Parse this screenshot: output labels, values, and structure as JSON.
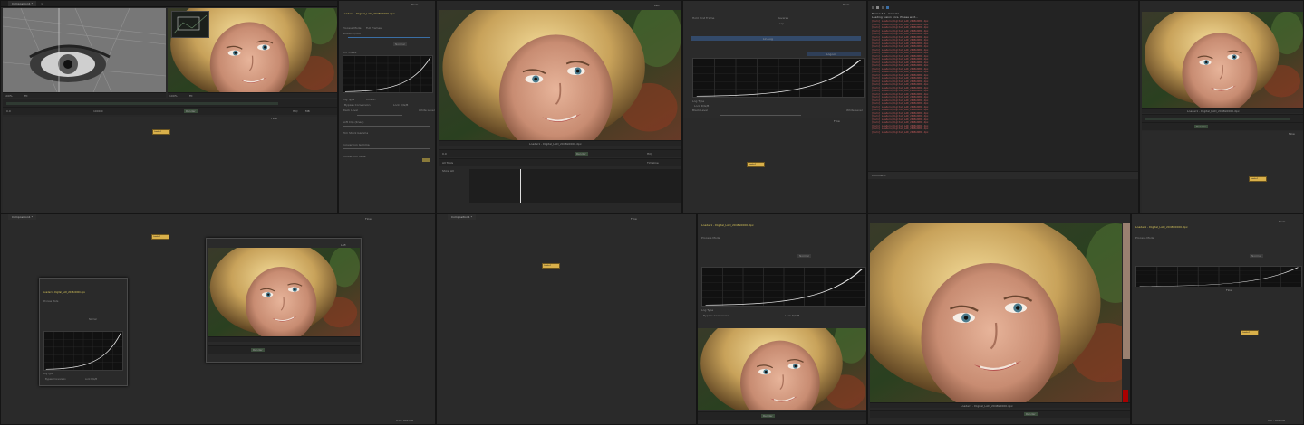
{
  "composition_tab": "Composition1 *",
  "loader_name": "Loader1 - Digital_LAD_2048x0000.dpx",
  "filename_caption": "Loader1 - Digital_LAD_2048x0000.dpx",
  "node_label": "Loader1",
  "inspector": {
    "tools_tab": "Tools",
    "modifiers_tab": "Modifiers",
    "process_mode_label": "Process Mode",
    "process_mode_value": "Full Frames",
    "global_in_label": "Global In/Out",
    "global_in_value": "0.0",
    "global_out_value": "100.0",
    "hold_label": "Hold First Frame",
    "reverse_label": "Reverse",
    "loop_label": "Loop",
    "normal_label": "Normal",
    "bypass_label": "Bypass Conversion",
    "lock_label": "Lock R/G/B",
    "log_type_label": "Log Type",
    "log_type_value": "Cineon",
    "black_level_label": "Black Level",
    "white_level_label": "White Level",
    "black_level_value": "95",
    "white_level_value": "685",
    "soft_clip_label": "Soft Clip (Knee)",
    "film_stock_label": "Film Stock Gamma",
    "conversion_gamma_label": "Conversion Gamma",
    "conversion_table_label": "Conversion Table",
    "lin_log_label": "Lin-Log",
    "log_lin_label": "Log-Lin",
    "curve_label": "LUT Curve"
  },
  "viewer": {
    "left_label": "Left",
    "right_label": "Right",
    "zoom": "100%",
    "fit": "Fit",
    "frame_start": "0.0",
    "frame_end": "1000.0",
    "render_label": "Render",
    "hiq": "HiQ",
    "mb": "MB",
    "prx": "Prx",
    "aprx": "APrx",
    "some_label": "Some"
  },
  "flow_panel": {
    "flow_tab": "Flow",
    "console_tab": "Console",
    "timeline_tab": "Timeline",
    "spline_tab": "Spline",
    "status": "0% - 404 MB"
  },
  "timeline_panel": {
    "title": "Timeline",
    "all_tools": "All Tools",
    "show_all": "Show All"
  },
  "console_panel": {
    "search_label": "Search",
    "command_label": "Command",
    "header": "Fusion 7.0 - Console",
    "header2": "Loading fusion core. Please wait...",
    "lines": [
      "[Warn] Loaders/Digital_LAD_2048x0000.dpx",
      "[Warn] Loaders/Digital_LAD_2048x0000.dpx",
      "[Warn] Loaders/Digital_LAD_2048x0000.dpx",
      "[Warn] Loaders/Digital_LAD_2048x0000.dpx",
      "[Warn] Loaders/Digital_LAD_2048x0000.dpx",
      "[Warn] Loaders/Digital_LAD_2048x0000.dpx",
      "[Warn] Loaders/Digital_LAD_2048x0000.dpx",
      "[Warn] Loaders/Digital_LAD_2048x0000.dpx",
      "[Warn] Loaders/Digital_LAD_2048x0000.dpx",
      "[Warn] Loaders/Digital_LAD_2048x0000.dpx",
      "[Warn] Loaders/Digital_LAD_2048x0000.dpx",
      "[Warn] Loaders/Digital_LAD_2048x0000.dpx",
      "[Warn] Loaders/Digital_LAD_2048x0000.dpx",
      "[Warn] Loaders/Digital_LAD_2048x0000.dpx",
      "[Warn] Loaders/Digital_LAD_2048x0000.dpx",
      "[Warn] Loaders/Digital_LAD_2048x0000.dpx",
      "[Warn] Loaders/Digital_LAD_2048x0000.dpx",
      "[Warn] Loaders/Digital_LAD_2048x0000.dpx",
      "[Warn] Loaders/Digital_LAD_2048x0000.dpx",
      "[Warn] Loaders/Digital_LAD_2048x0000.dpx",
      "[Warn] Loaders/Digital_LAD_2048x0000.dpx",
      "[Warn] Loaders/Digital_LAD_2048x0000.dpx",
      "[Warn] Loaders/Digital_LAD_2048x0000.dpx",
      "[Warn] Loaders/Digital_LAD_2048x0000.dpx",
      "[Warn] Loaders/Digital_LAD_2048x0000.dpx",
      "[Warn] Loaders/Digital_LAD_2048x0000.dpx",
      "[Warn] Loaders/Digital_LAD_2048x0000.dpx",
      "[Warn] Loaders/Digital_LAD_2048x0000.dpx",
      "[Warn] Loaders/Digital_LAD_2048x0000.dpx",
      "[Warn] Loaders/Digital_LAD_2048x0000.dpx",
      "[Warn] Loaders/Digital_LAD_2048x0000.dpx",
      "[Warn] Loaders/Digital_LAD_2048x0000.dpx",
      "[Warn] Loaders/Digital_LAD_2048x0000.dpx",
      "[Warn] Loaders/Digital_LAD_2048x0000.dpx",
      "[Warn] Loaders/Digital_LAD_2048x0000.dpx",
      "[Warn] Loaders/Digital_LAD_2048x0000.dpx"
    ]
  },
  "colors": {
    "node": "#d9b04a",
    "accent": "#3a6ea5",
    "console_error": "#c85b5b",
    "title_yellow": "#d6c45a"
  }
}
